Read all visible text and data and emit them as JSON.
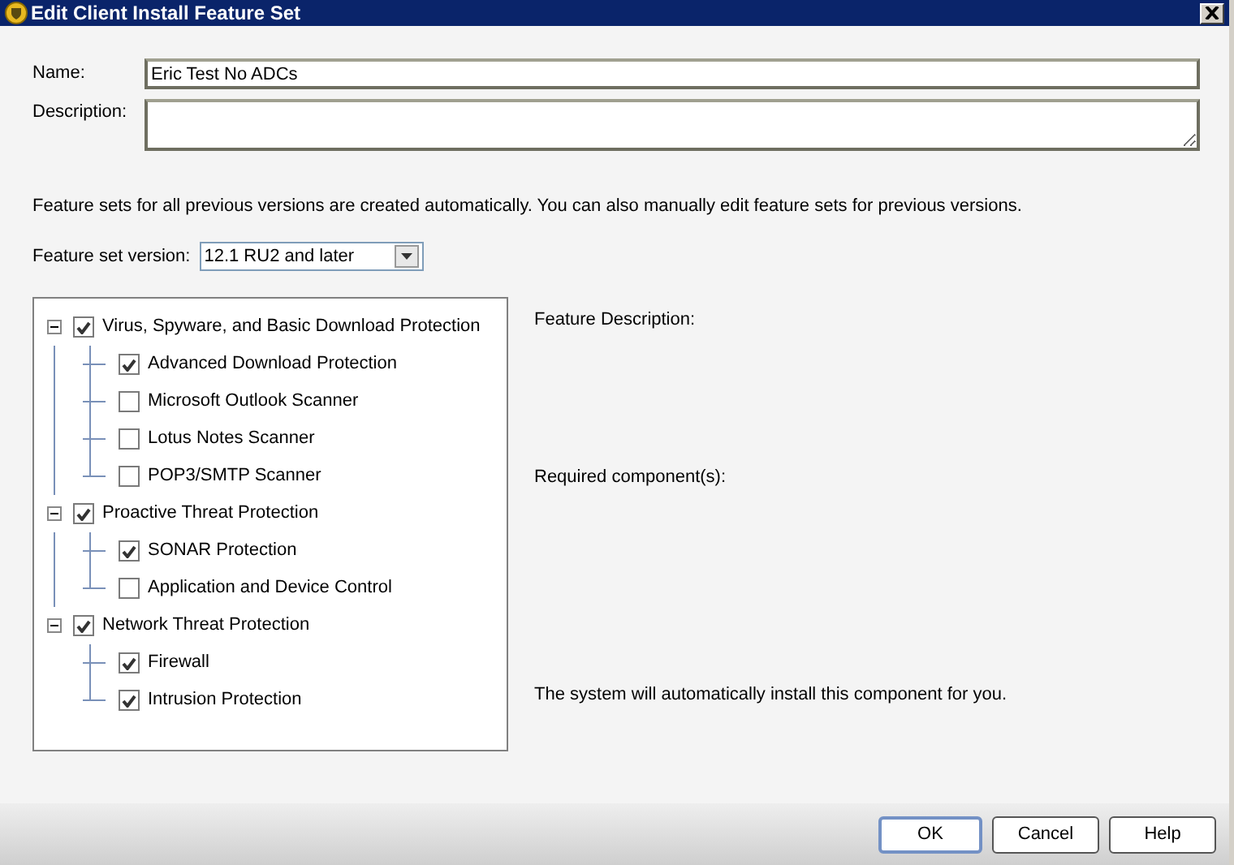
{
  "window": {
    "title": "Edit Client Install Feature Set"
  },
  "name": {
    "label": "Name:",
    "value": "Eric Test No ADCs"
  },
  "description": {
    "label": "Description:"
  },
  "info": "Feature sets for all previous versions are created automatically. You can also manually edit feature sets for previous versions.",
  "version": {
    "label": "Feature set version:",
    "value": "12.1 RU2 and later"
  },
  "features": [
    {
      "label": "Virus, Spyware, and Basic Download Protection",
      "checked": true,
      "expanded": true,
      "children": [
        {
          "label": "Advanced Download Protection",
          "checked": true
        },
        {
          "label": "Microsoft Outlook Scanner",
          "checked": false
        },
        {
          "label": "Lotus Notes Scanner",
          "checked": false
        },
        {
          "label": "POP3/SMTP Scanner",
          "checked": false
        }
      ]
    },
    {
      "label": "Proactive Threat Protection",
      "checked": true,
      "expanded": true,
      "children": [
        {
          "label": "SONAR Protection",
          "checked": true
        },
        {
          "label": "Application and Device Control",
          "checked": false
        }
      ]
    },
    {
      "label": "Network Threat Protection",
      "checked": true,
      "expanded": true,
      "children": [
        {
          "label": "Firewall",
          "checked": true
        },
        {
          "label": "Intrusion Protection",
          "checked": true
        }
      ]
    }
  ],
  "details": {
    "description_label": "Feature Description:",
    "components_label": "Required component(s):",
    "note": "The system will automatically install this component for you."
  },
  "buttons": [
    {
      "label": "OK",
      "default": true
    },
    {
      "label": "Cancel",
      "default": false
    },
    {
      "label": "Help",
      "default": false
    }
  ]
}
